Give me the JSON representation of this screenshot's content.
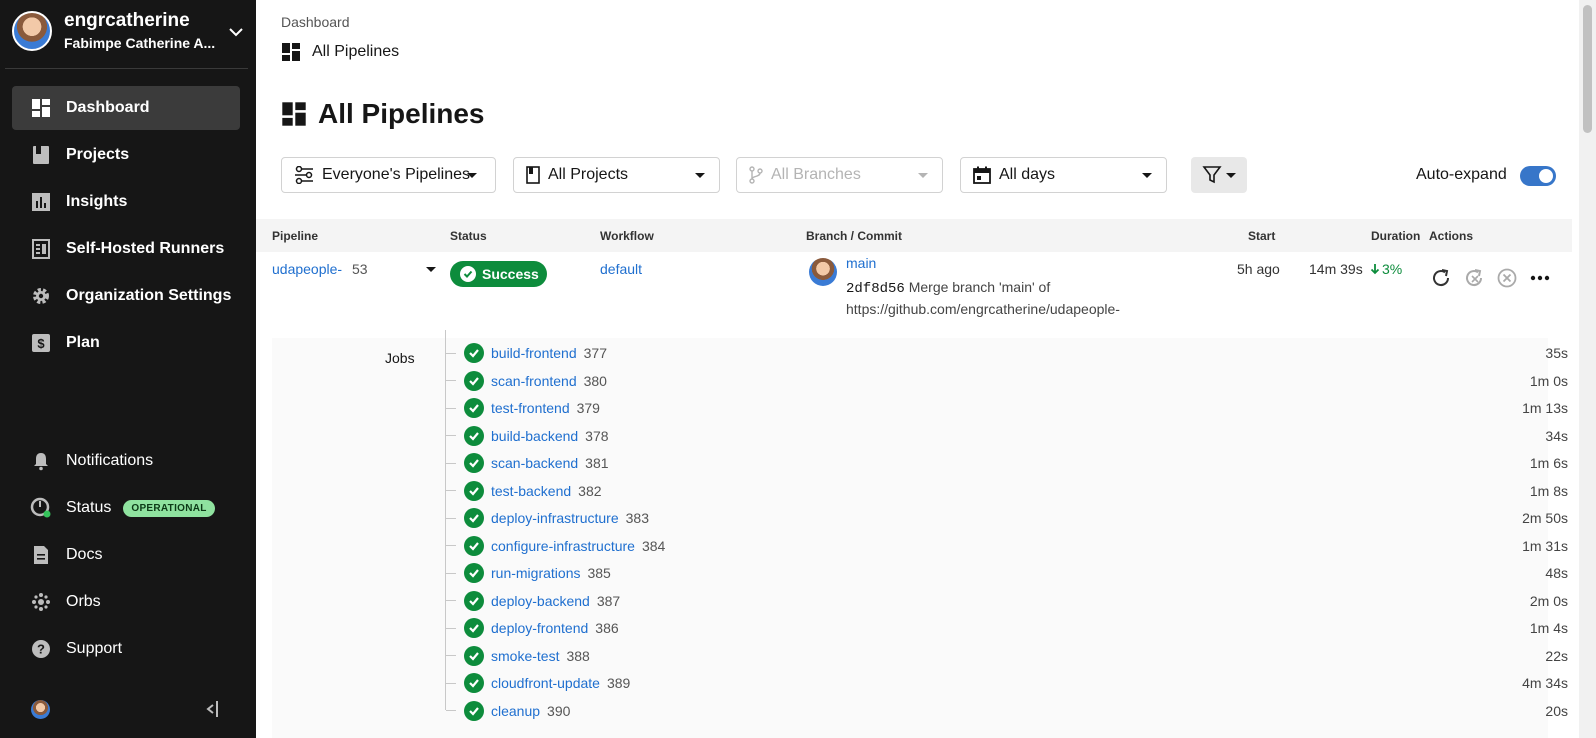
{
  "sidebar": {
    "username": "engrcatherine",
    "org": "Fabimpe Catherine A...",
    "nav": [
      {
        "label": "Dashboard",
        "icon": "dashboard-icon",
        "active": true
      },
      {
        "label": "Projects",
        "icon": "projects-icon"
      },
      {
        "label": "Insights",
        "icon": "insights-icon"
      },
      {
        "label": "Self-Hosted Runners",
        "icon": "runners-icon"
      },
      {
        "label": "Organization Settings",
        "icon": "gear-icon"
      },
      {
        "label": "Plan",
        "icon": "dollar-icon"
      }
    ],
    "bottom": [
      {
        "label": "Notifications",
        "icon": "bell-icon"
      },
      {
        "label": "Status",
        "icon": "status-icon",
        "badge": "OPERATIONAL"
      },
      {
        "label": "Docs",
        "icon": "document-icon"
      },
      {
        "label": "Orbs",
        "icon": "orbs-icon"
      },
      {
        "label": "Support",
        "icon": "help-icon"
      }
    ]
  },
  "header": {
    "breadcrumb": "Dashboard",
    "subtitle": "All Pipelines",
    "title": "All Pipelines"
  },
  "filters": {
    "pipelines": "Everyone's Pipelines",
    "projects": "All Projects",
    "branches": "All Branches",
    "days": "All days",
    "auto_expand": "Auto-expand"
  },
  "table": {
    "headers": {
      "pipeline": "Pipeline",
      "status": "Status",
      "workflow": "Workflow",
      "branch": "Branch / Commit",
      "start": "Start",
      "duration": "Duration",
      "actions": "Actions"
    },
    "row": {
      "pipeline_name": "udapeople-",
      "pipeline_number": "53",
      "status": "Success",
      "workflow": "default",
      "branch": "main",
      "commit_sha": "2df8d56",
      "commit_msg_1": "Merge branch 'main' of",
      "commit_msg_2": "https://github.com/engrcatherine/udapeople-",
      "start": "5h ago",
      "duration": "14m 39s",
      "change": "3%"
    },
    "jobs_label": "Jobs",
    "jobs": [
      {
        "name": "build-frontend",
        "num": "377",
        "dur": "35s"
      },
      {
        "name": "scan-frontend",
        "num": "380",
        "dur": "1m 0s"
      },
      {
        "name": "test-frontend",
        "num": "379",
        "dur": "1m 13s"
      },
      {
        "name": "build-backend",
        "num": "378",
        "dur": "34s"
      },
      {
        "name": "scan-backend",
        "num": "381",
        "dur": "1m 6s"
      },
      {
        "name": "test-backend",
        "num": "382",
        "dur": "1m 8s"
      },
      {
        "name": "deploy-infrastructure",
        "num": "383",
        "dur": "2m 50s"
      },
      {
        "name": "configure-infrastructure",
        "num": "384",
        "dur": "1m 31s"
      },
      {
        "name": "run-migrations",
        "num": "385",
        "dur": "48s"
      },
      {
        "name": "deploy-backend",
        "num": "387",
        "dur": "2m 0s"
      },
      {
        "name": "deploy-frontend",
        "num": "386",
        "dur": "1m 4s"
      },
      {
        "name": "smoke-test",
        "num": "388",
        "dur": "22s"
      },
      {
        "name": "cloudfront-update",
        "num": "389",
        "dur": "4m 34s"
      },
      {
        "name": "cleanup",
        "num": "390",
        "dur": "20s"
      }
    ]
  },
  "colors": {
    "sidebar_bg": "#161616",
    "success": "#0d8c3c",
    "link": "#1f6fcf",
    "toggle": "#3776c9",
    "operational_badge": "#8fe29f"
  }
}
